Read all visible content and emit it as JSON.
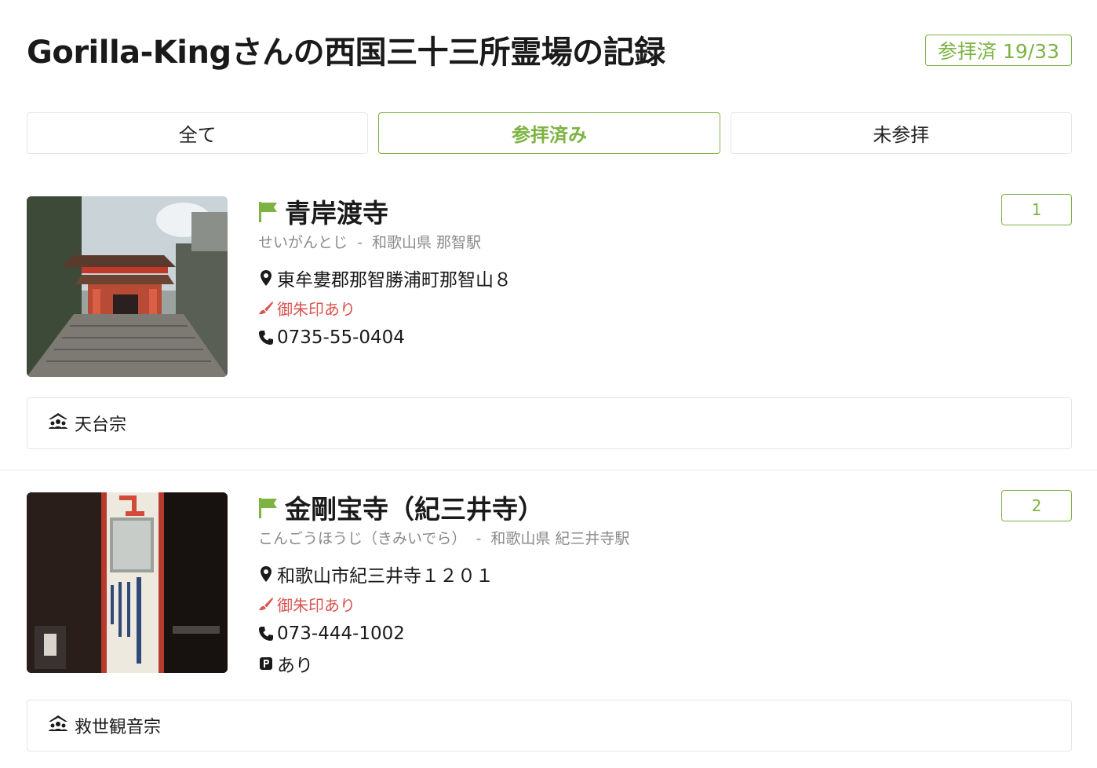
{
  "header": {
    "title": "Gorilla-Kingさんの西国三十三所霊場の記録",
    "progress_label": "参拝済 19/33"
  },
  "tabs": [
    {
      "label": "全て",
      "active": false
    },
    {
      "label": "参拝済み",
      "active": true
    },
    {
      "label": "未参拝",
      "active": false
    }
  ],
  "colors": {
    "accent": "#7cb342",
    "goshuin": "#d9534f",
    "muted": "#8a8a8a"
  },
  "temples": [
    {
      "name": "青岸渡寺",
      "reading": "せいがんとじ",
      "separator": "-",
      "location": "和歌山県 那智駅",
      "address": "東牟婁郡那智勝浦町那智山８",
      "goshuin": "御朱印あり",
      "phone": "0735-55-0404",
      "number": "1",
      "sect": "天台宗",
      "icons": [
        "flag-icon",
        "map-pin-icon",
        "brush-icon",
        "phone-icon",
        "temple-icon"
      ]
    },
    {
      "name": "金剛宝寺（紀三井寺）",
      "reading": "こんごうほうじ（きみいでら）",
      "separator": "-",
      "location": "和歌山県 紀三井寺駅",
      "address": "和歌山市紀三井寺１２０１",
      "goshuin": "御朱印あり",
      "phone": "073-444-1002",
      "parking": "あり",
      "number": "2",
      "sect": "救世観音宗",
      "icons": [
        "flag-icon",
        "map-pin-icon",
        "brush-icon",
        "phone-icon",
        "parking-icon",
        "temple-icon"
      ]
    }
  ]
}
